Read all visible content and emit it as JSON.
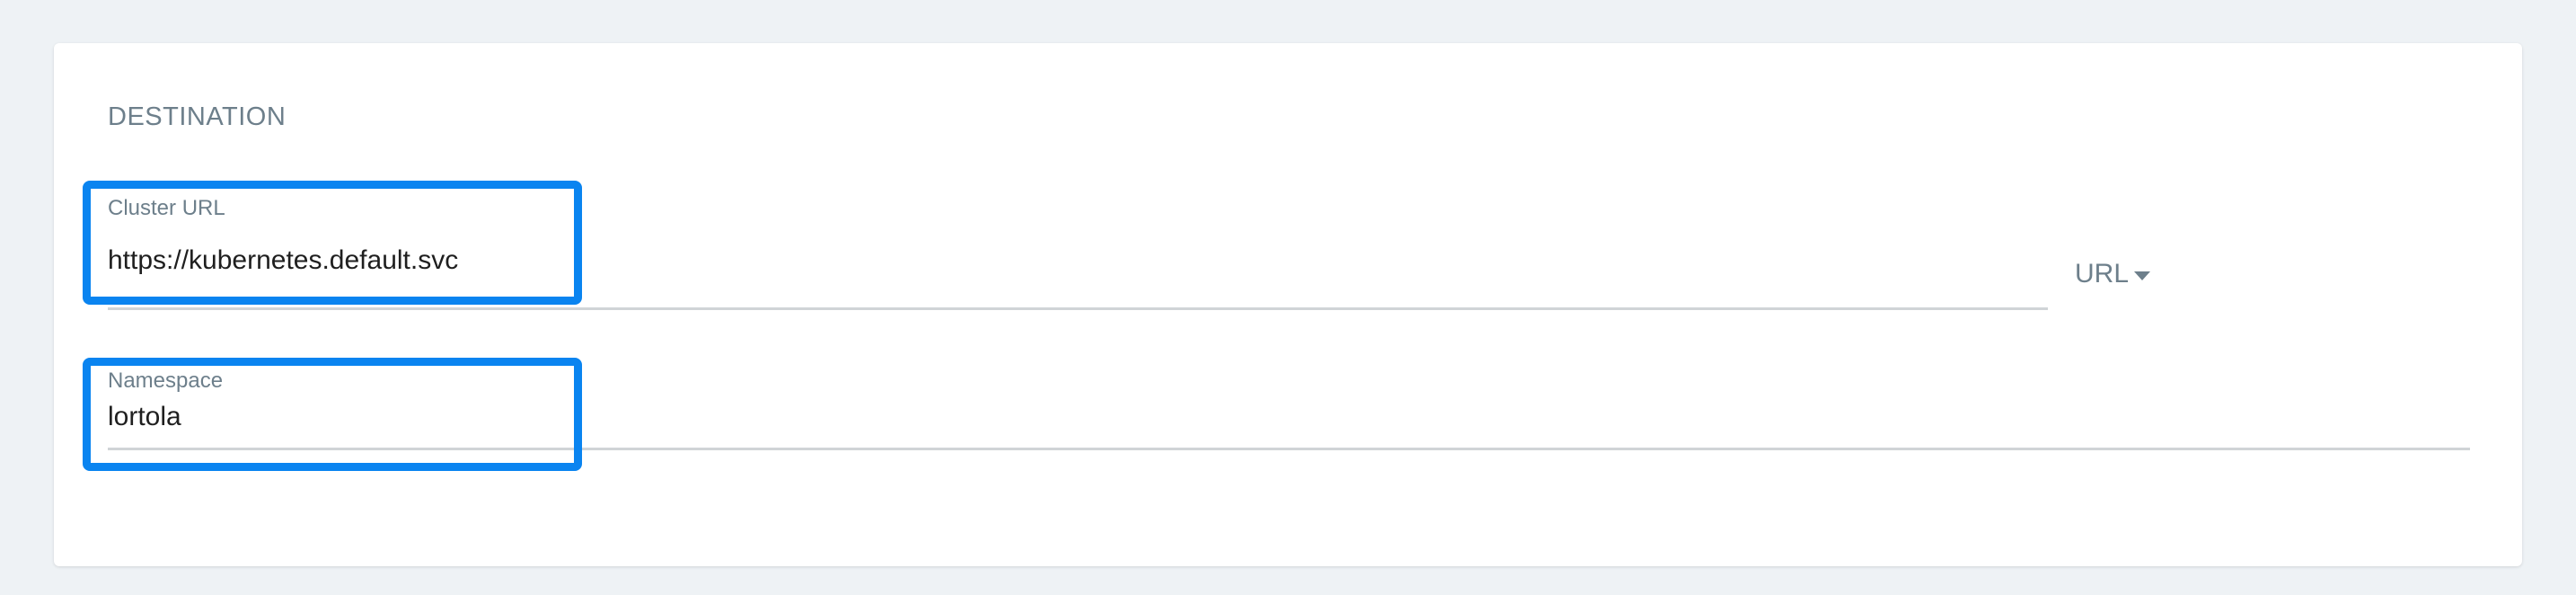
{
  "section": {
    "title": "DESTINATION"
  },
  "cluster_url": {
    "label": "Cluster URL",
    "value": "https://kubernetes.default.svc"
  },
  "type_selector": {
    "value": "URL",
    "icon": "caret-down-icon"
  },
  "namespace": {
    "label": "Namespace",
    "value": "lortola"
  },
  "colors": {
    "highlight": "#0a84f0",
    "label": "#6d7f8b",
    "underline": "#d0d4d7"
  }
}
